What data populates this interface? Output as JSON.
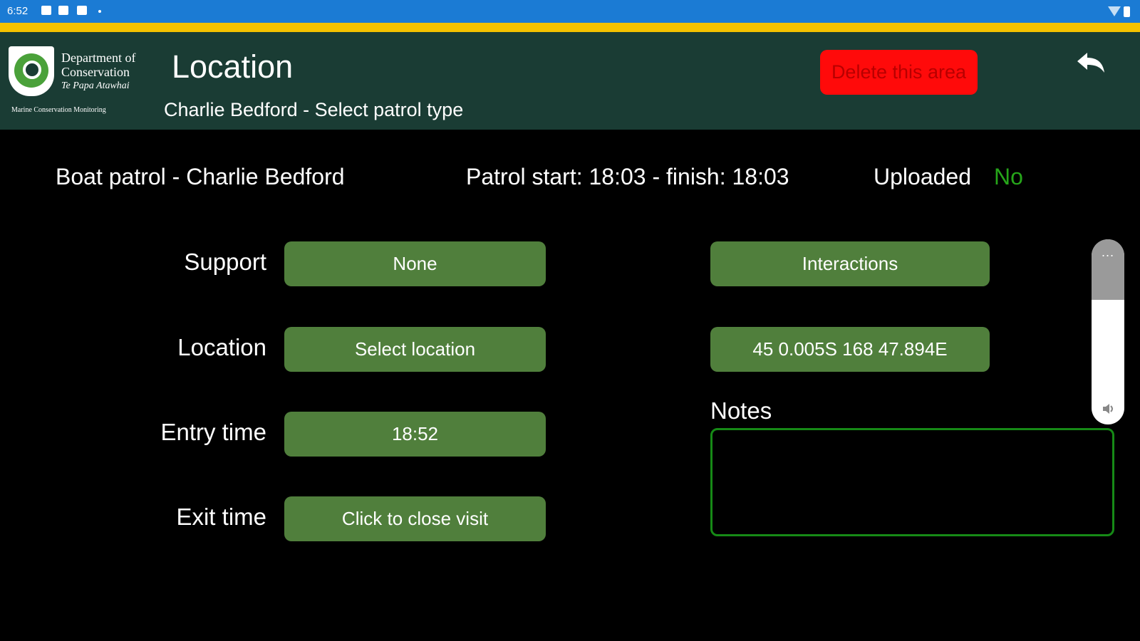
{
  "status_bar": {
    "time": "6:52",
    "icons": [
      "calendar-icon",
      "gmail-icon",
      "photo-icon",
      "dot-icon"
    ],
    "right_icons": [
      "wifi-icon",
      "battery-icon"
    ]
  },
  "header": {
    "logo": {
      "line1": "Department of",
      "line2": "Conservation",
      "line3": "Te Papa Atawhai",
      "caption": "Marine Conservation Monitoring"
    },
    "title": "Location",
    "subtitle": "Charlie  Bedford - Select patrol type",
    "delete_label": "Delete this area",
    "back_icon": "back-arrow-icon"
  },
  "info": {
    "patrol": "Boat patrol - Charlie  Bedford",
    "times": "Patrol start: 18:03 - finish: 18:03",
    "uploaded_label": "Uploaded",
    "uploaded_value": "No"
  },
  "form": {
    "support_label": "Support",
    "support_value": "None",
    "location_label": "Location",
    "location_value": "Select location",
    "entry_label": "Entry time",
    "entry_value": "18:52",
    "exit_label": "Exit time",
    "exit_value": "Click to close visit",
    "interactions_label": "Interactions",
    "coordinates": "45 0.005S 168 47.894E",
    "notes_label": "Notes",
    "notes_value": ""
  },
  "volume_panel": {
    "menu": "...",
    "icon": "speaker-icon",
    "level": 0.67
  },
  "colors": {
    "status_bar": "#1b7bd4",
    "accent": "#f4c200",
    "header": "#1a3c34",
    "button": "#507f3c",
    "delete": "#ff0a0a",
    "uploaded_no": "#26a51a"
  }
}
